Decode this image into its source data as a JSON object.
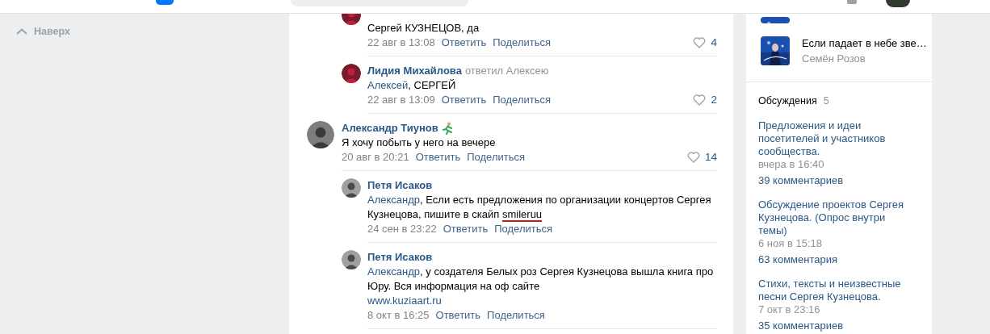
{
  "sidebar": {
    "back_to_top": "Наверх"
  },
  "comments": [
    {
      "kind": "reply",
      "text": "Сергей КУЗНЕЦОВ, да",
      "date": "22 авг в 13:08",
      "actions": [
        "Ответить",
        "Поделиться"
      ],
      "likes": "4"
    },
    {
      "kind": "reply",
      "author": "Лидия Михайлова",
      "note": "ответил Алексею",
      "reply_to": "Алексей",
      "text": ", СЕРГЕЙ",
      "date": "22 авг в 13:09",
      "actions": [
        "Ответить",
        "Поделиться"
      ],
      "likes": "2"
    },
    {
      "kind": "comment",
      "author": "Александр Тиунов",
      "badge": true,
      "text": "Я хочу побыть у него на вечере",
      "date": "20 авг в 20:21",
      "actions": [
        "Ответить",
        "Поделиться"
      ],
      "likes": "14"
    },
    {
      "kind": "reply",
      "author": "Петя Исаков",
      "reply_to": "Александр",
      "text": ", Если есть предложения по организации концертов Сергея Кузнецова, пишите в скайп ",
      "marked": "smileruu",
      "date": "24 сен в 23:22",
      "actions": [
        "Ответить",
        "Поделиться"
      ]
    },
    {
      "kind": "reply",
      "author": "Петя Исаков",
      "reply_to": "Александр",
      "text": ", у создателя Белых роз Сергея Кузнецова вышла книга про Юру. Вся информация на оф сайте",
      "link": "www.kuziaart.ru",
      "date": "8 окт в 16:25",
      "actions": [
        "Ответить",
        "Поделиться"
      ]
    }
  ],
  "playlist": [
    {
      "title": "Если падает в небе зве…",
      "artist": "Семён Розов"
    }
  ],
  "discussions": {
    "title": "Обсуждения",
    "count": "5",
    "topics": [
      {
        "title": "Предложения и идеи посетителей и участников сообщества.",
        "date": "вчера в 16:40",
        "comments": "39 комментариев"
      },
      {
        "title": "Обсуждение проектов Сергея Кузнецова. (Опрос внутри темы)",
        "date": "6 ноя в 15:18",
        "comments": "63 комментария"
      },
      {
        "title": "Стихи, тексты и неизвестные песни Сергея Кузнецова.",
        "date": "7 окт в 23:16",
        "comments": "35 комментариев"
      }
    ]
  }
}
